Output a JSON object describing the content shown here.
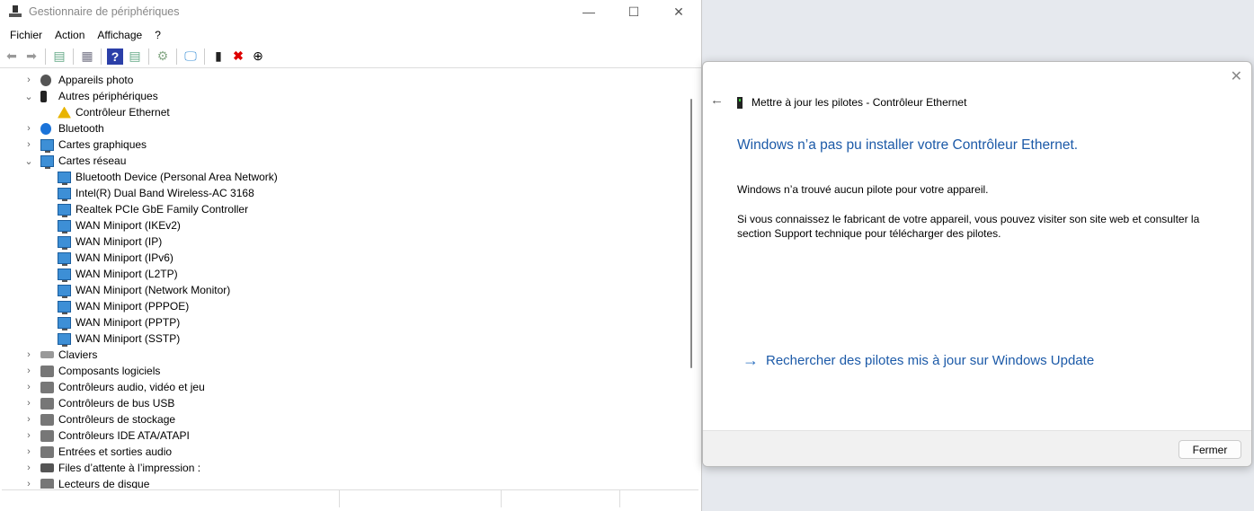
{
  "window": {
    "title": "Gestionnaire de périphériques",
    "minimize": "—",
    "maximize": "☐",
    "close": "✕"
  },
  "menu": [
    "Fichier",
    "Action",
    "Affichage",
    "?"
  ],
  "tree": [
    {
      "label": "Appareils photo",
      "level": 0,
      "chev": "›",
      "icon": "camera-icon"
    },
    {
      "label": "Autres périphériques",
      "level": 0,
      "chev": "⌄",
      "icon": "unknown-device-icon"
    },
    {
      "label": "Contrôleur Ethernet",
      "level": 1,
      "chev": "",
      "icon": "warning-device-icon"
    },
    {
      "label": "Bluetooth",
      "level": 0,
      "chev": "›",
      "icon": "bluetooth-icon"
    },
    {
      "label": "Cartes graphiques",
      "level": 0,
      "chev": "›",
      "icon": "display-adapter-icon"
    },
    {
      "label": "Cartes réseau",
      "level": 0,
      "chev": "⌄",
      "icon": "network-adapter-icon"
    },
    {
      "label": "Bluetooth Device (Personal Area Network)",
      "level": 1,
      "chev": "",
      "icon": "network-adapter-icon"
    },
    {
      "label": "Intel(R) Dual Band Wireless-AC 3168",
      "level": 1,
      "chev": "",
      "icon": "network-adapter-icon"
    },
    {
      "label": "Realtek PCIe GbE Family Controller",
      "level": 1,
      "chev": "",
      "icon": "network-adapter-icon"
    },
    {
      "label": "WAN Miniport (IKEv2)",
      "level": 1,
      "chev": "",
      "icon": "network-adapter-icon"
    },
    {
      "label": "WAN Miniport (IP)",
      "level": 1,
      "chev": "",
      "icon": "network-adapter-icon"
    },
    {
      "label": "WAN Miniport (IPv6)",
      "level": 1,
      "chev": "",
      "icon": "network-adapter-icon"
    },
    {
      "label": "WAN Miniport (L2TP)",
      "level": 1,
      "chev": "",
      "icon": "network-adapter-icon"
    },
    {
      "label": "WAN Miniport (Network Monitor)",
      "level": 1,
      "chev": "",
      "icon": "network-adapter-icon"
    },
    {
      "label": "WAN Miniport (PPPOE)",
      "level": 1,
      "chev": "",
      "icon": "network-adapter-icon"
    },
    {
      "label": "WAN Miniport (PPTP)",
      "level": 1,
      "chev": "",
      "icon": "network-adapter-icon"
    },
    {
      "label": "WAN Miniport (SSTP)",
      "level": 1,
      "chev": "",
      "icon": "network-adapter-icon"
    },
    {
      "label": "Claviers",
      "level": 0,
      "chev": "›",
      "icon": "keyboard-icon"
    },
    {
      "label": "Composants logiciels",
      "level": 0,
      "chev": "›",
      "icon": "software-component-icon"
    },
    {
      "label": "Contrôleurs audio, vidéo et jeu",
      "level": 0,
      "chev": "›",
      "icon": "audio-icon"
    },
    {
      "label": "Contrôleurs de bus USB",
      "level": 0,
      "chev": "›",
      "icon": "usb-icon"
    },
    {
      "label": "Contrôleurs de stockage",
      "level": 0,
      "chev": "›",
      "icon": "storage-icon"
    },
    {
      "label": "Contrôleurs IDE ATA/ATAPI",
      "level": 0,
      "chev": "›",
      "icon": "ide-icon"
    },
    {
      "label": "Entrées et sorties audio",
      "level": 0,
      "chev": "›",
      "icon": "speaker-icon"
    },
    {
      "label": "Files d’attente à l’impression :",
      "level": 0,
      "chev": "›",
      "icon": "printer-icon"
    },
    {
      "label": "Lecteurs de disque",
      "level": 0,
      "chev": "›",
      "icon": "disk-icon"
    }
  ],
  "dialog": {
    "close": "✕",
    "back": "←",
    "header": "Mettre à jour les pilotes - Contrôleur Ethernet",
    "title": "Windows n’a pas pu installer votre Contrôleur Ethernet.",
    "p1": "Windows n’a trouvé aucun pilote pour votre appareil.",
    "p2": "Si vous connaissez le fabricant de votre appareil, vous pouvez visiter son site web et consulter la section Support technique pour télécharger des pilotes.",
    "link": "Rechercher des pilotes mis à jour sur Windows Update",
    "link_arrow": "→",
    "close_button": "Fermer"
  },
  "colors": {
    "accent": "#1c5aa8"
  }
}
